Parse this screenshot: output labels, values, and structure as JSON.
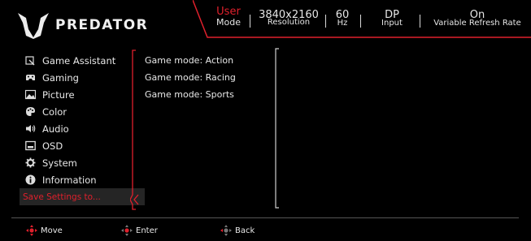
{
  "brand": {
    "name": "PREDATOR",
    "logo_icon": "predator-logo-icon"
  },
  "status": {
    "mode_value": "User",
    "mode_label": "Mode",
    "resolution_value": "3840x2160",
    "resolution_label": "Resolution",
    "refresh_value": "60",
    "refresh_label": "Hz",
    "input_value": "DP",
    "input_label": "Input",
    "vrr_value": "On",
    "vrr_label": "Variable Refresh Rate"
  },
  "menu": {
    "items": [
      {
        "label": "Game Assistant",
        "icon": "game-assistant-icon"
      },
      {
        "label": "Gaming",
        "icon": "gamepad-icon"
      },
      {
        "label": "Picture",
        "icon": "picture-icon"
      },
      {
        "label": "Color",
        "icon": "palette-icon"
      },
      {
        "label": "Audio",
        "icon": "speaker-icon"
      },
      {
        "label": "OSD",
        "icon": "osd-icon"
      },
      {
        "label": "System",
        "icon": "gear-icon"
      },
      {
        "label": "Information",
        "icon": "info-icon"
      }
    ],
    "save_label": "Save Settings to..."
  },
  "game_modes": [
    {
      "label": "Game mode:",
      "value": "Action"
    },
    {
      "label": "Game mode:",
      "value": "Racing"
    },
    {
      "label": "Game mode:",
      "value": "Sports"
    }
  ],
  "footer": {
    "move_label": "Move",
    "enter_label": "Enter",
    "back_label": "Back"
  },
  "colors": {
    "accent": "#e0202c",
    "background": "#000000",
    "selected": "#252525"
  }
}
